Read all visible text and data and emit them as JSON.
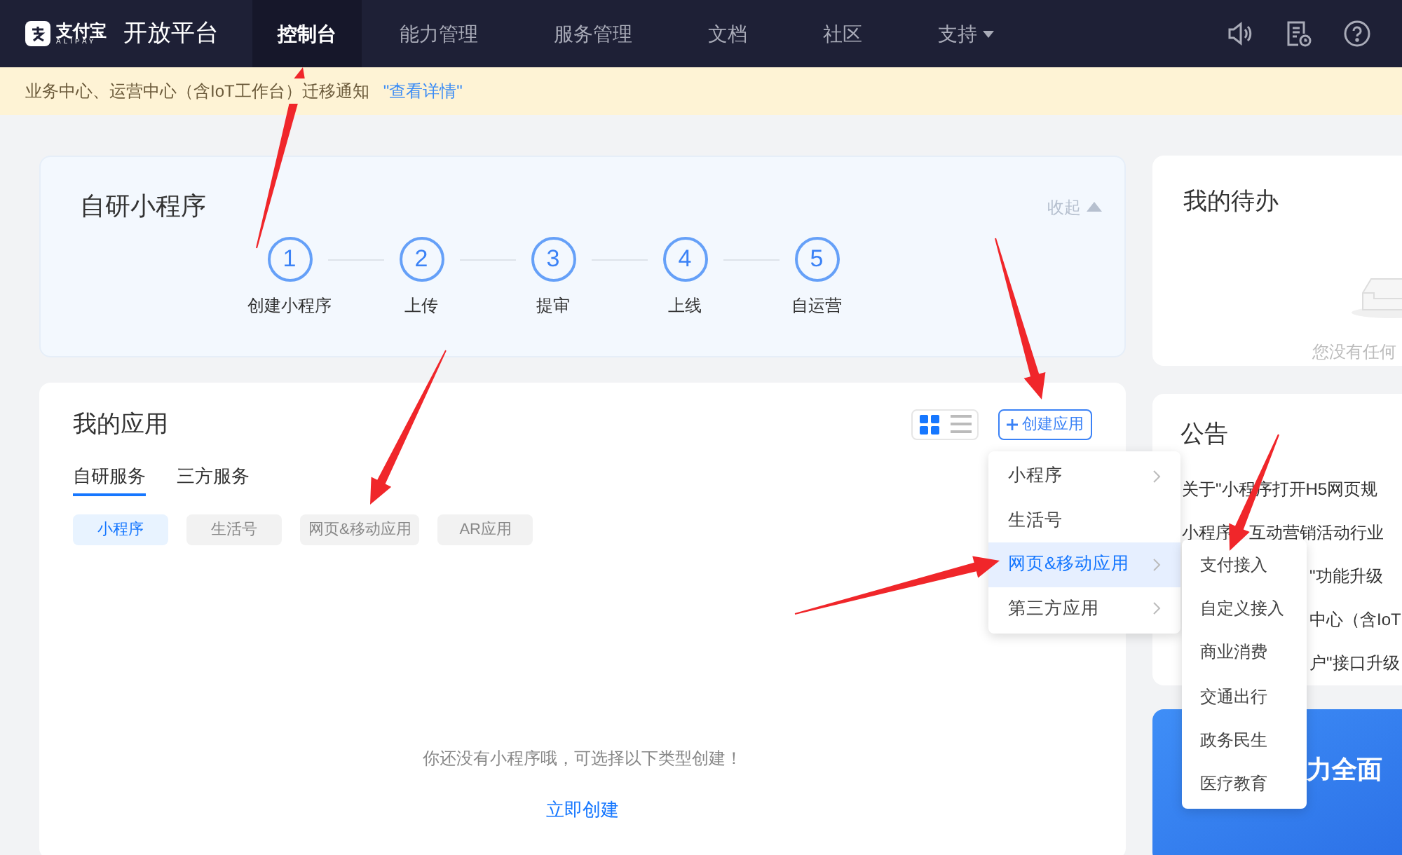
{
  "nav": {
    "logo": {
      "mark": "支付宝",
      "sub": "ALIPAY"
    },
    "title": "开放平台",
    "tabs": [
      {
        "label": "控制台",
        "selected": true,
        "caret": false
      },
      {
        "label": "能力管理",
        "selected": false,
        "caret": false
      },
      {
        "label": "服务管理",
        "selected": false,
        "caret": false
      },
      {
        "label": "文档",
        "selected": false,
        "caret": false
      },
      {
        "label": "社区",
        "selected": false,
        "caret": false
      },
      {
        "label": "支持",
        "selected": false,
        "caret": true
      }
    ]
  },
  "notice": {
    "text": "业务中心、运营中心（含IoT工作台）迁移通知",
    "link": "\"查看详情\""
  },
  "guide": {
    "title": "自研小程序",
    "collapse": "收起",
    "steps": [
      {
        "number": "1",
        "label": "创建小程序"
      },
      {
        "number": "2",
        "label": "上传"
      },
      {
        "number": "3",
        "label": "提审"
      },
      {
        "number": "4",
        "label": "上线"
      },
      {
        "number": "5",
        "label": "自运营"
      }
    ]
  },
  "apps": {
    "title": "我的应用",
    "views": [
      {
        "kind": "grid",
        "selected": true
      },
      {
        "kind": "list",
        "selected": false
      }
    ],
    "create_button": "创建应用",
    "tabs": [
      {
        "label": "自研服务",
        "selected": true
      },
      {
        "label": "三方服务",
        "selected": false
      }
    ],
    "filters": [
      {
        "label": "小程序",
        "selected": true
      },
      {
        "label": "生活号",
        "selected": false
      },
      {
        "label": "网页&移动应用",
        "selected": false
      },
      {
        "label": "AR应用",
        "selected": false
      }
    ],
    "empty_text": "你还没有小程序哦，可选择以下类型创建！",
    "create_link": "立即创建",
    "menu": [
      {
        "label": "小程序",
        "selected": false,
        "submenu": true
      },
      {
        "label": "生活号",
        "selected": false,
        "submenu": false
      },
      {
        "label": "网页&移动应用",
        "selected": true,
        "submenu": true
      },
      {
        "label": "第三方应用",
        "selected": false,
        "submenu": true
      }
    ],
    "submenu": [
      "支付接入",
      "自定义接入",
      "商业消费",
      "交通出行",
      "政务民生",
      "医疗教育"
    ]
  },
  "todo": {
    "title": "我的待办",
    "empty_text": "您没有任何"
  },
  "announcements": {
    "title": "公告",
    "items": [
      "关于\"小程序打开H5网页规",
      "小程序　互动营销活动行业",
      "\"功能升级",
      "中心（含IoT",
      "户\"接口升级"
    ]
  },
  "banner": {
    "text": "力全面"
  }
}
